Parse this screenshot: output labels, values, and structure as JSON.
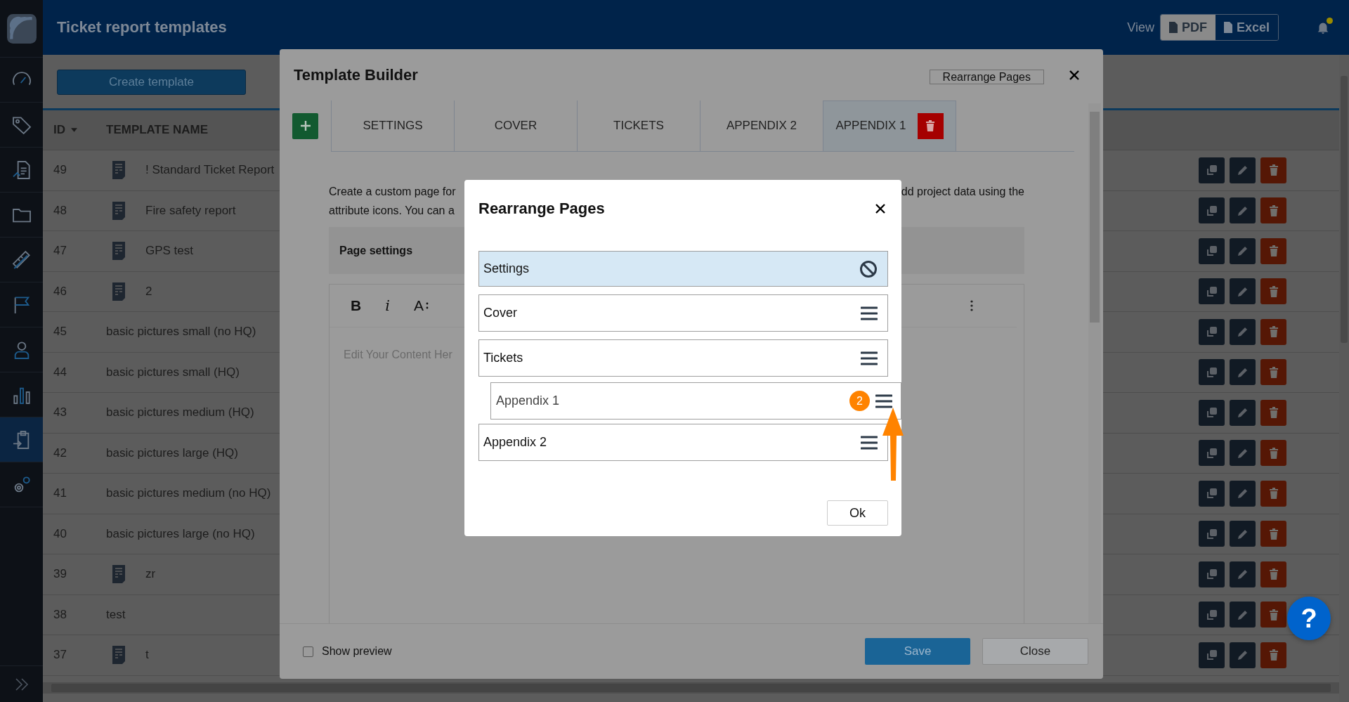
{
  "sidebar": {
    "items": [
      {
        "selected": false
      },
      {
        "selected": false
      },
      {
        "selected": false
      },
      {
        "selected": false
      },
      {
        "selected": false
      },
      {
        "selected": false
      },
      {
        "selected": false
      },
      {
        "selected": false
      },
      {
        "selected": true
      },
      {
        "selected": false
      }
    ]
  },
  "header": {
    "title": "Ticket report templates",
    "view_label": "View",
    "view_options": [
      {
        "label": "PDF",
        "selected": true
      },
      {
        "label": "Excel",
        "selected": false
      }
    ],
    "notification_dot": true
  },
  "toolbar": {
    "create_button": "Create template"
  },
  "table": {
    "columns": [
      {
        "label": "ID",
        "sorted": true
      },
      {
        "label": "TEMPLATE NAME",
        "sorted": false
      }
    ],
    "rows": [
      {
        "id": "49",
        "name": "! Standard Ticket Report",
        "has_icon": true
      },
      {
        "id": "48",
        "name": "Fire safety report",
        "has_icon": true
      },
      {
        "id": "47",
        "name": "GPS test",
        "has_icon": true
      },
      {
        "id": "46",
        "name": "2",
        "has_icon": true
      },
      {
        "id": "45",
        "name": "basic pictures small (no HQ)",
        "has_icon": false
      },
      {
        "id": "44",
        "name": "basic pictures small (HQ)",
        "has_icon": false
      },
      {
        "id": "43",
        "name": "basic pictures medium (HQ)",
        "has_icon": false
      },
      {
        "id": "42",
        "name": "basic pictures large (HQ)",
        "has_icon": false
      },
      {
        "id": "41",
        "name": "basic pictures medium (no HQ)",
        "has_icon": false
      },
      {
        "id": "40",
        "name": "basic pictures large (no HQ)",
        "has_icon": false
      },
      {
        "id": "39",
        "name": "zr",
        "has_icon": true
      },
      {
        "id": "38",
        "name": "test",
        "has_icon": false
      },
      {
        "id": "37",
        "name": "t",
        "has_icon": true
      }
    ]
  },
  "template_builder": {
    "title": "Template Builder",
    "rearrange_button": "Rearrange Pages",
    "tabs": [
      {
        "label": "SETTINGS",
        "selected": false,
        "deletable": false
      },
      {
        "label": "COVER",
        "selected": false,
        "deletable": false
      },
      {
        "label": "TICKETS",
        "selected": false,
        "deletable": false
      },
      {
        "label": "APPENDIX 2",
        "selected": false,
        "deletable": false
      },
      {
        "label": "APPENDIX 1",
        "selected": true,
        "deletable": true
      }
    ],
    "description_left": [
      "Create a custom page for",
      "attribute icons. You can a"
    ],
    "description_right": "dd project data using the",
    "page_settings": "Page settings",
    "editor_tools": [
      {
        "kind": "bold",
        "label": "B"
      },
      {
        "kind": "italic",
        "label": "i"
      },
      {
        "kind": "font-size",
        "label": "A"
      }
    ],
    "editor_placeholder": "Edit Your Content Her",
    "show_preview": {
      "label": "Show preview",
      "checked": false
    },
    "save_button": "Save",
    "close_button": "Close"
  },
  "rearrange_dialog": {
    "title": "Rearrange Pages",
    "pages": [
      {
        "label": "Settings",
        "locked": true,
        "dragging": false
      },
      {
        "label": "Cover",
        "locked": false,
        "dragging": false
      },
      {
        "label": "Tickets",
        "locked": false,
        "dragging": false
      },
      {
        "label": "Appendix 1",
        "locked": false,
        "dragging": true,
        "badge": "2"
      },
      {
        "label": "Appendix 2",
        "locked": false,
        "dragging": false
      }
    ],
    "ok_button": "Ok",
    "arrow_annotation": true
  },
  "help_button": "?"
}
